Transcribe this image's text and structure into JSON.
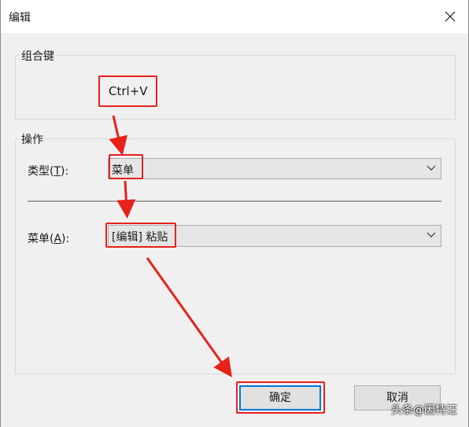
{
  "window": {
    "title": "编辑"
  },
  "hotkey_group": {
    "label": "组合键",
    "value": "Ctrl+V"
  },
  "action_group": {
    "label": "操作",
    "type_label_prefix": "类型(",
    "type_label_key": "T",
    "type_label_suffix": "):",
    "type_value": "菜单",
    "menu_label_prefix": "菜单(",
    "menu_label_key": "A",
    "menu_label_suffix": "):",
    "menu_value": "[编辑] 粘贴"
  },
  "buttons": {
    "ok": "确定",
    "cancel": "取消"
  },
  "watermark": "头条@因特汪",
  "colors": {
    "highlight": "#e8211b",
    "default_button_border": "#0078d7",
    "dialog_bg": "#f0f0f0"
  },
  "icons": [
    "close-icon",
    "chevron-down-icon"
  ]
}
